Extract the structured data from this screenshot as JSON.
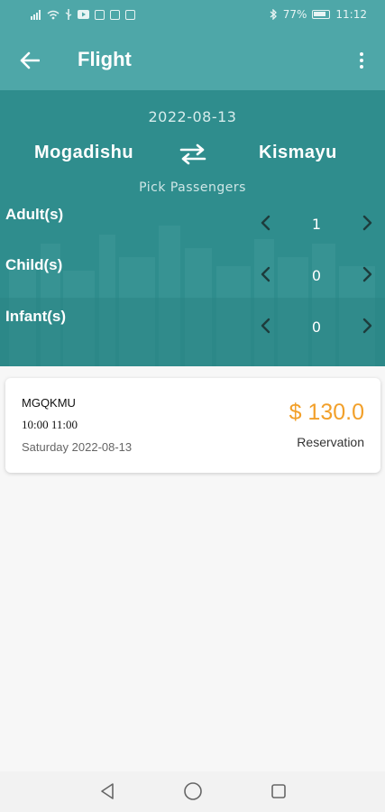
{
  "status_bar": {
    "battery": "77%",
    "time": "11:12",
    "icons": [
      "signal-icon",
      "wifi-icon",
      "usb-icon",
      "youtube-icon",
      "image-icon",
      "android-icon",
      "photo-icon",
      "bluetooth-icon",
      "battery-icon"
    ]
  },
  "app_bar": {
    "title": "Flight",
    "back_icon": "arrow-left-icon",
    "menu_icon": "more-vertical-icon"
  },
  "search": {
    "date": "2022-08-13",
    "from": "Mogadishu",
    "to": "Kismayu",
    "swap_icon": "swap-arrows-icon",
    "pick_passengers_label": "Pick Passengers"
  },
  "passengers": [
    {
      "label": "Adult(s)",
      "count": "1"
    },
    {
      "label": "Child(s)",
      "count": "0"
    },
    {
      "label": "Infant(s)",
      "count": "0"
    }
  ],
  "flight_card": {
    "code": "MGQKMU",
    "times": "10:00 11:00",
    "date_line": "Saturday 2022-08-13",
    "price": "$ 130.0",
    "status": "Reservation"
  },
  "colors": {
    "app_bar": "#4ea7a8",
    "hero": "#2f8d8d",
    "price": "#f2a02a"
  }
}
